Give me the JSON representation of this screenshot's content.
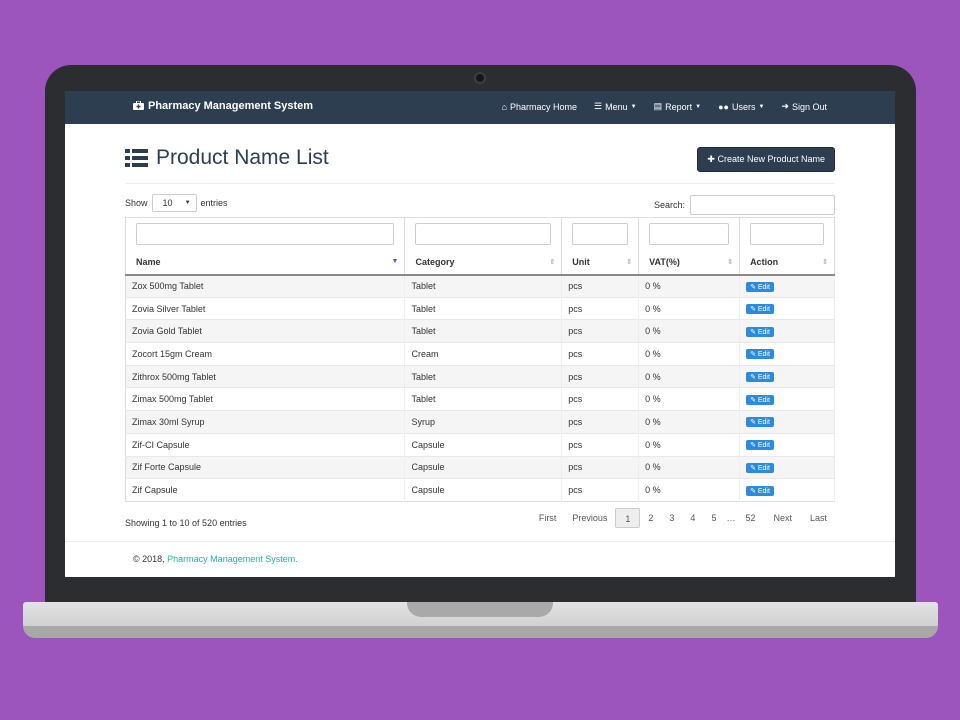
{
  "navbar": {
    "brand": "Pharmacy Management System",
    "items": [
      {
        "label": "Pharmacy Home",
        "icon": "home-icon",
        "caret": false
      },
      {
        "label": "Menu",
        "icon": "list-icon",
        "caret": true
      },
      {
        "label": "Report",
        "icon": "file-icon",
        "caret": true
      },
      {
        "label": "Users",
        "icon": "users-icon",
        "caret": true
      },
      {
        "label": "Sign Out",
        "icon": "sign-out-icon",
        "caret": false
      }
    ]
  },
  "page": {
    "title": "Product Name List",
    "create_button": "Create New Product Name"
  },
  "controls": {
    "show_label": "Show",
    "entries_value": "10",
    "entries_label": "entries",
    "search_label": "Search:"
  },
  "table": {
    "columns": [
      "Name",
      "Category",
      "Unit",
      "VAT(%)",
      "Action"
    ],
    "rows": [
      {
        "name": "Zox 500mg Tablet",
        "category": "Tablet",
        "unit": "pcs",
        "vat": "0 %",
        "action": "Edit"
      },
      {
        "name": "Zovia Silver Tablet",
        "category": "Tablet",
        "unit": "pcs",
        "vat": "0 %",
        "action": "Edit"
      },
      {
        "name": "Zovia Gold Tablet",
        "category": "Tablet",
        "unit": "pcs",
        "vat": "0 %",
        "action": "Edit"
      },
      {
        "name": "Zocort 15gm Cream",
        "category": "Cream",
        "unit": "pcs",
        "vat": "0 %",
        "action": "Edit"
      },
      {
        "name": "Zithrox 500mg Tablet",
        "category": "Tablet",
        "unit": "pcs",
        "vat": "0 %",
        "action": "Edit"
      },
      {
        "name": "Zimax 500mg Tablet",
        "category": "Tablet",
        "unit": "pcs",
        "vat": "0 %",
        "action": "Edit"
      },
      {
        "name": "Zimax 30ml Syrup",
        "category": "Syrup",
        "unit": "pcs",
        "vat": "0 %",
        "action": "Edit"
      },
      {
        "name": "Zif-CI Capsule",
        "category": "Capsule",
        "unit": "pcs",
        "vat": "0 %",
        "action": "Edit"
      },
      {
        "name": "Zif Forte Capsule",
        "category": "Capsule",
        "unit": "pcs",
        "vat": "0 %",
        "action": "Edit"
      },
      {
        "name": "Zif Capsule",
        "category": "Capsule",
        "unit": "pcs",
        "vat": "0 %",
        "action": "Edit"
      }
    ]
  },
  "pagination": {
    "info": "Showing 1 to 10 of 520 entries",
    "first": "First",
    "previous": "Previous",
    "pages": [
      "1",
      "2",
      "3",
      "4",
      "5"
    ],
    "ellipsis": "…",
    "last_page": "52",
    "next": "Next",
    "last": "Last"
  },
  "footer": {
    "copyright": "© 2018,",
    "link": "Pharmacy Management System."
  }
}
